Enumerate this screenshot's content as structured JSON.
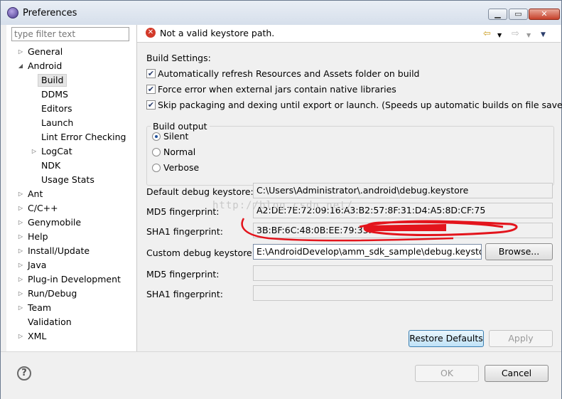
{
  "window": {
    "title": "Preferences"
  },
  "filter": {
    "placeholder": "type filter text"
  },
  "tree": [
    {
      "label": "General",
      "arrow": "▷",
      "level": 0
    },
    {
      "label": "Android",
      "arrow": "◢",
      "level": 0
    },
    {
      "label": "Build",
      "arrow": "",
      "level": 1,
      "selected": true
    },
    {
      "label": "DDMS",
      "arrow": "",
      "level": 1
    },
    {
      "label": "Editors",
      "arrow": "",
      "level": 1
    },
    {
      "label": "Launch",
      "arrow": "",
      "level": 1
    },
    {
      "label": "Lint Error Checking",
      "arrow": "",
      "level": 1
    },
    {
      "label": "LogCat",
      "arrow": "▷",
      "level": 1
    },
    {
      "label": "NDK",
      "arrow": "",
      "level": 1
    },
    {
      "label": "Usage Stats",
      "arrow": "",
      "level": 1
    },
    {
      "label": "Ant",
      "arrow": "▷",
      "level": 0
    },
    {
      "label": "C/C++",
      "arrow": "▷",
      "level": 0
    },
    {
      "label": "Genymobile",
      "arrow": "▷",
      "level": 0
    },
    {
      "label": "Help",
      "arrow": "▷",
      "level": 0
    },
    {
      "label": "Install/Update",
      "arrow": "▷",
      "level": 0
    },
    {
      "label": "Java",
      "arrow": "▷",
      "level": 0
    },
    {
      "label": "Plug-in Development",
      "arrow": "▷",
      "level": 0
    },
    {
      "label": "Run/Debug",
      "arrow": "▷",
      "level": 0
    },
    {
      "label": "Team",
      "arrow": "▷",
      "level": 0
    },
    {
      "label": "Validation",
      "arrow": "",
      "level": 0
    },
    {
      "label": "XML",
      "arrow": "▷",
      "level": 0
    }
  ],
  "message": {
    "text": "Not a valid keystore path."
  },
  "build": {
    "heading": "Build Settings:",
    "options": [
      {
        "label": "Automatically refresh Resources and Assets folder on build",
        "checked": true
      },
      {
        "label": "Force error when external jars contain native libraries",
        "checked": true
      },
      {
        "label": "Skip packaging and dexing until export or launch. (Speeds up automatic builds on file save)",
        "checked": true
      }
    ],
    "output_title": "Build output",
    "outputs": [
      {
        "label": "Silent",
        "selected": true
      },
      {
        "label": "Normal",
        "selected": false
      },
      {
        "label": "Verbose",
        "selected": false
      }
    ]
  },
  "keystore": {
    "default_label": "Default debug keystore:",
    "default_value": "C:\\Users\\Administrator\\.android\\debug.keystore",
    "md5_label": "MD5 fingerprint:",
    "md5_value": "A2:DE:7E:72:09:16:A3:B2:57:8F:31:D4:A5:8D:CF:75",
    "sha1_label": "SHA1 fingerprint:",
    "sha1_value": "3B:BF:6C:48:0B:EE:79:33:",
    "custom_label": "Custom debug keystore:",
    "custom_value": "E:\\AndroidDevelop\\amm_sdk_sample\\debug.keystore",
    "browse_label": "Browse...",
    "custom_md5_label": "MD5 fingerprint:",
    "custom_sha1_label": "SHA1 fingerprint:"
  },
  "watermark": "http://blog.csdn.net/",
  "buttons": {
    "restore": "Restore Defaults",
    "apply": "Apply",
    "ok": "OK",
    "cancel": "Cancel",
    "help": "?"
  }
}
